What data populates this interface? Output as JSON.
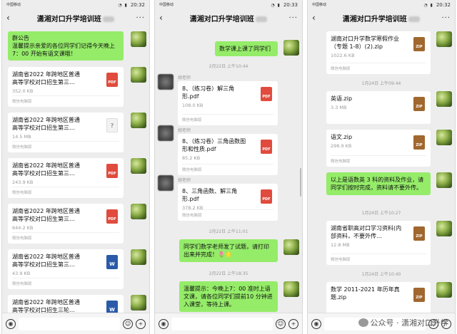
{
  "chat_title": "潇湘对口升学培训班",
  "status": {
    "carrier": "中国移动",
    "p1_time": "20:32",
    "p2_time": "20:33",
    "p3_time": "20:32"
  },
  "teacher_name": "胡老师",
  "file_source": "微信电脑版",
  "phone1": {
    "announcement_title": "群公告",
    "announcement_text": "温馨提示亲爱的各位同学们记得今天晚上7：00 开始有语文课哦！",
    "files": [
      {
        "name": "湖南省2022 年跨地区普通高等学校对口招生第三…",
        "size": "352.0 KB",
        "type": "PDF"
      },
      {
        "name": "湖南省2022 年跨地区普通高等学校对口招生第三…",
        "size": "14.5 MB",
        "type": "?"
      },
      {
        "name": "湖南省2022 年跨地区普通高等学校对口招生第三…",
        "size": "243.9 KB",
        "type": "PDF"
      },
      {
        "name": "湖南省2022 年跨地区普通高等学校对口招生第三…",
        "size": "644.2 KB",
        "type": "PDF"
      },
      {
        "name": "湖南省2022 年跨地区普通高等学校对口招生第三…",
        "size": "43.9 KB",
        "type": "W"
      },
      {
        "name": "湖南省2022 年跨地区普通高等学校对口招生三轮…",
        "size": "",
        "type": "W"
      }
    ]
  },
  "phone2": {
    "msg1": "数学课上课了同学们",
    "ts1": "2月22日 上午10:44",
    "files": [
      {
        "name": "8、（练习卷）解三角形.pdf",
        "size": "108.0 KB",
        "type": "PDF"
      },
      {
        "name": "8、（练习卷）三角函数图形和性质.pdf",
        "size": "85.2 KB",
        "type": "PDF"
      },
      {
        "name": "8、三角函数、解三角形.pdf",
        "size": "378.2 KB",
        "type": "PDF"
      }
    ],
    "ts2": "2月22日 上午11:01",
    "msg2": "同学们数学老师发了试题，请打印出来并完成！🌷🌟",
    "ts3": "2月22日 上午18:35",
    "msg3": "温馨提示：今晚上7：00 准时上语文课，请各位同学们提前10 分钟进入课堂，等待上课。"
  },
  "phone3": {
    "files_top": [
      {
        "name": "湖南对口升学数学寒假作业（专题 1-8）(2).zip",
        "size": "1022.6 KB",
        "type": "ZIP"
      }
    ],
    "ts1": "1月24日 上午09:44",
    "files_mid": [
      {
        "name": "英语.zip",
        "size": "3.3 MB",
        "type": "ZIP"
      },
      {
        "name": "语文.zip",
        "size": "298.9 KB",
        "type": "ZIP"
      }
    ],
    "msg1": "以上是语数英 3 科的资料及作业，请同学们按时完成，资料请不要外传。",
    "ts2": "1月24日 上午10:27",
    "file4": {
      "name": "湖南省职高对口学习资料(内部资料，不要外传…",
      "size": "12.8 MB",
      "type": "ZIP"
    },
    "ts3": "1月24日 上午10:40",
    "file5": {
      "name": "数学 2011-2021 年历年真题.zip",
      "size": "",
      "type": "ZIP"
    }
  },
  "watermark": "公众号 · 潇湘对口升学"
}
